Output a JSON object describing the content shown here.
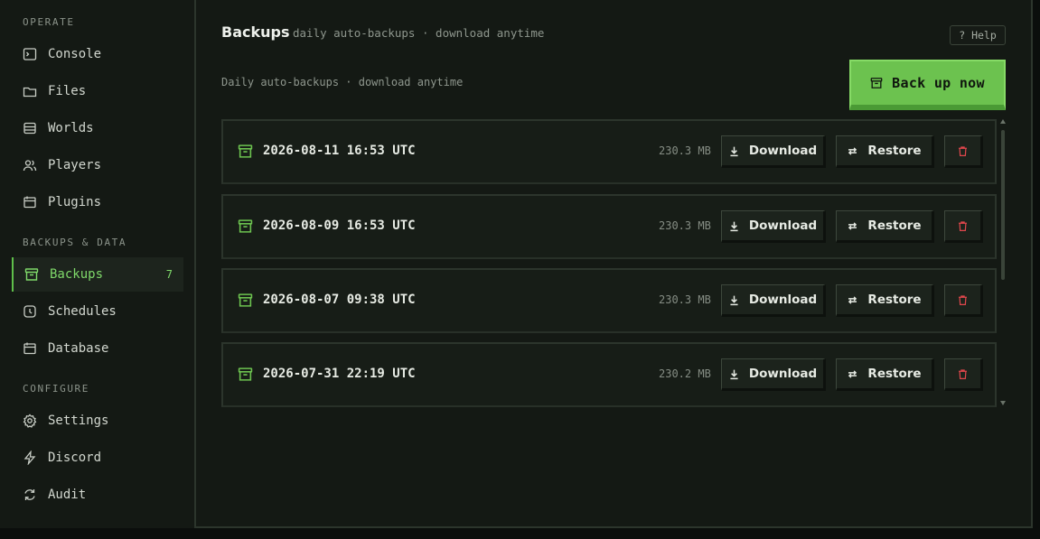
{
  "sidebar": {
    "sections": [
      {
        "title": "OPERATE"
      },
      {
        "title": "BACKUPS & DATA"
      },
      {
        "title": "CONFIGURE"
      }
    ],
    "items": [
      {
        "label": "Console",
        "icon": "terminal-icon"
      },
      {
        "label": "Files",
        "icon": "folder-icon"
      },
      {
        "label": "Worlds",
        "icon": "database-icon"
      },
      {
        "label": "Players",
        "icon": "users-icon"
      },
      {
        "label": "Plugins",
        "icon": "plugin-icon"
      },
      {
        "label": "Backups",
        "icon": "archive-icon",
        "count": "7",
        "active": true
      },
      {
        "label": "Schedules",
        "icon": "clock-icon"
      },
      {
        "label": "Database",
        "icon": "table-icon"
      },
      {
        "label": "Settings",
        "icon": "settings-icon"
      },
      {
        "label": "Discord",
        "icon": "bolt-icon"
      },
      {
        "label": "Audit",
        "icon": "refresh-icon"
      }
    ]
  },
  "header": {
    "title": "Backups",
    "subtitle": "daily auto-backups · download anytime",
    "help_label": "? Help"
  },
  "description": "Daily auto-backups · download anytime",
  "backup_now_label": "Back up now",
  "backups": [
    {
      "date": "2026-08-11 16:53 UTC",
      "size": "230.3 MB"
    },
    {
      "date": "2026-08-09 16:53 UTC",
      "size": "230.3 MB"
    },
    {
      "date": "2026-08-07 09:38 UTC",
      "size": "230.3 MB"
    },
    {
      "date": "2026-07-31 22:19 UTC",
      "size": "230.2 MB"
    }
  ],
  "actions": {
    "download_label": "Download",
    "restore_label": "Restore"
  },
  "colors": {
    "accent": "#6cc24f",
    "danger": "#e0474c",
    "background": "#141914"
  }
}
